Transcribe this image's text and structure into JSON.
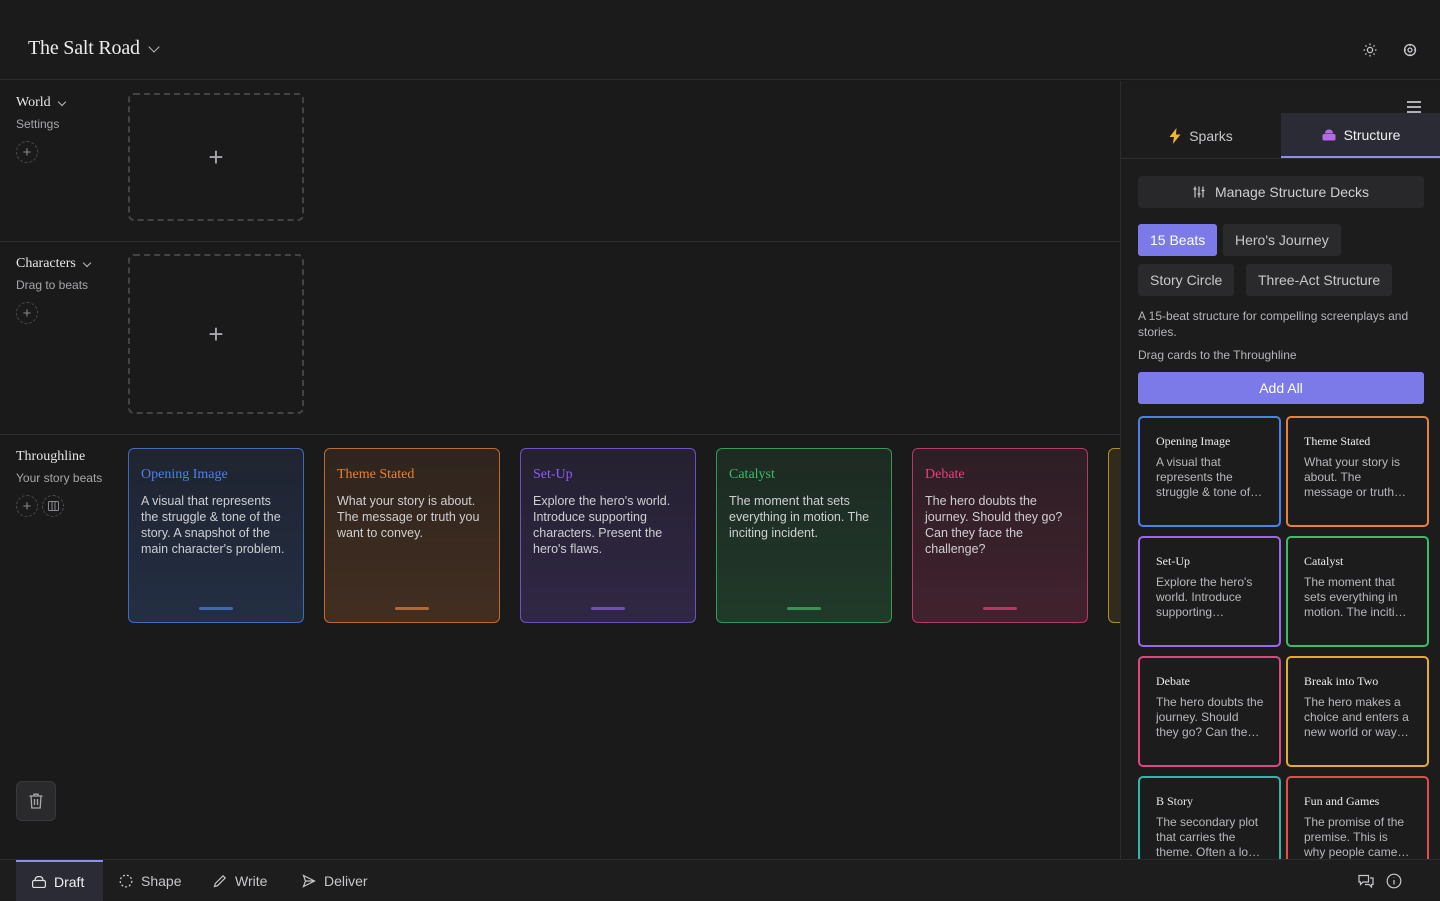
{
  "header": {
    "project_title": "The Salt Road"
  },
  "rows": {
    "world": {
      "name": "World",
      "sub": "Settings"
    },
    "characters": {
      "name": "Characters",
      "sub": "Drag to beats"
    },
    "throughline": {
      "name": "Throughline",
      "sub": "Your story beats"
    }
  },
  "dropzone_plus": "+",
  "throughline_beats": [
    {
      "title": "Opening Image",
      "desc": "A visual that represents the struggle & tone of the story. A snapshot of the main character's problem.",
      "color": "#4c82e8"
    },
    {
      "title": "Theme Stated",
      "desc": "What your story is about. The message or truth you want to convey.",
      "color": "#e8823a"
    },
    {
      "title": "Set-Up",
      "desc": "Explore the hero's world. Introduce supporting characters. Present the hero's flaws.",
      "color": "#8c5ff0"
    },
    {
      "title": "Catalyst",
      "desc": "The moment that sets everything in motion. The inciting incident.",
      "color": "#3dbb66"
    },
    {
      "title": "Debate",
      "desc": "The hero doubts the journey. Should they go? Can they face the challenge?",
      "color": "#e0457d"
    }
  ],
  "panel": {
    "tabs": [
      {
        "label": "Sparks",
        "active": false
      },
      {
        "label": "Structure",
        "active": true
      }
    ],
    "manage_label": "Manage Structure Decks",
    "decks": [
      "15 Beats",
      "Hero's Journey",
      "Story Circle",
      "Three-Act Structure"
    ],
    "active_deck": "15 Beats",
    "description": "A 15-beat structure for compelling screenplays and stories.",
    "hint": "Drag cards to the Throughline",
    "add_all": "Add All",
    "cards": [
      {
        "title": "Opening Image",
        "desc": "A visual that represents the struggle & tone of the story. A snapshot of the main character's problem.",
        "color": "#4c82e8"
      },
      {
        "title": "Theme Stated",
        "desc": "What your story is about. The message or truth you want to convey.",
        "color": "#e8823a"
      },
      {
        "title": "Set-Up",
        "desc": "Explore the hero's world. Introduce supporting characters. Present the hero's flaws.",
        "color": "#9a66f2"
      },
      {
        "title": "Catalyst",
        "desc": "The moment that sets everything in motion. The inciting incident.",
        "color": "#3dbb66"
      },
      {
        "title": "Debate",
        "desc": "The hero doubts the journey. Should they go? Can they face the challenge?",
        "color": "#e0457d"
      },
      {
        "title": "Break into Two",
        "desc": "The hero makes a choice and enters a new world or way of thinking.",
        "color": "#e2ad2a"
      },
      {
        "title": "B Story",
        "desc": "The secondary plot that carries the theme. Often a love story or mentor relationship.",
        "color": "#2db8a8"
      },
      {
        "title": "Fun and Games",
        "desc": "The promise of the premise. This is why people came to see the story.",
        "color": "#e0504a"
      }
    ]
  },
  "bottom_tabs": [
    {
      "label": "Draft",
      "active": true
    },
    {
      "label": "Shape",
      "active": false
    },
    {
      "label": "Write",
      "active": false
    },
    {
      "label": "Deliver",
      "active": false
    }
  ]
}
